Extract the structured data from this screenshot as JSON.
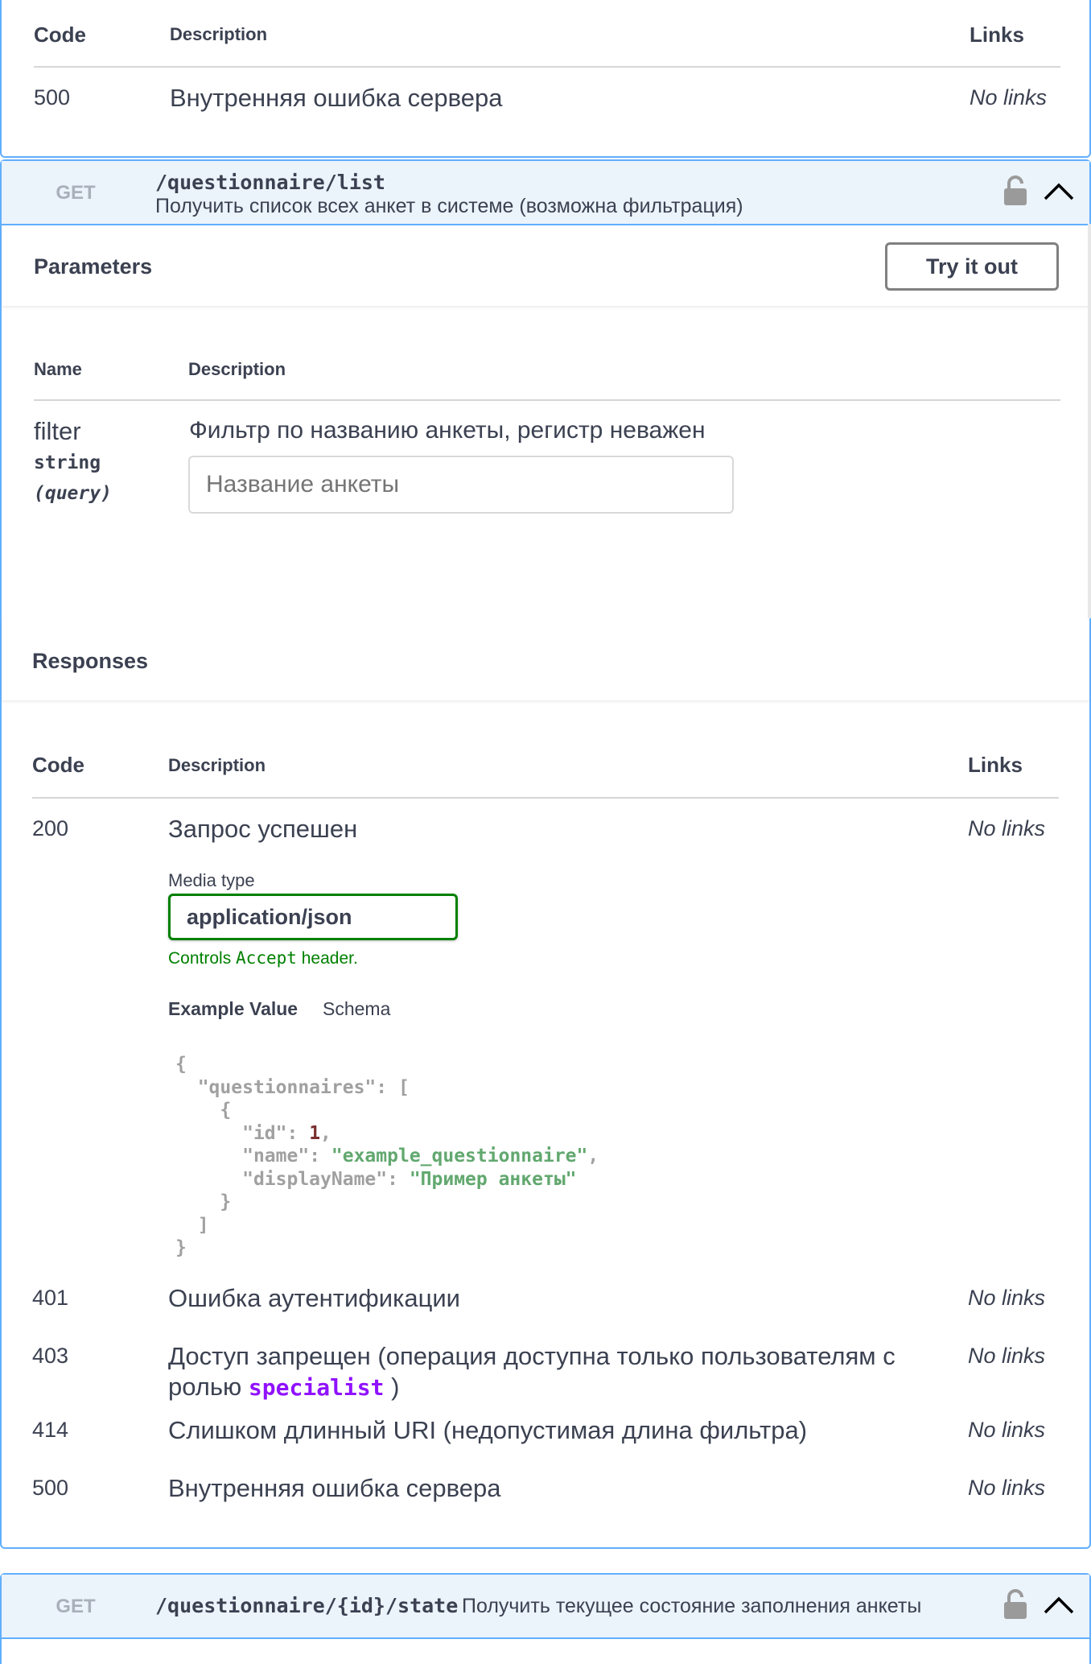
{
  "top_responses": {
    "headers": {
      "code": "Code",
      "description": "Description",
      "links": "Links"
    },
    "rows": [
      {
        "code": "500",
        "description": "Внутренняя ошибка сервера",
        "links": "No links"
      }
    ]
  },
  "op_list": {
    "method": "GET",
    "path": "/questionnaire/list",
    "summary": "Получить список всех анкет в системе (возможна фильтрация)",
    "parameters_title": "Parameters",
    "try_button": "Try it out",
    "param_headers": {
      "name": "Name",
      "description": "Description"
    },
    "param": {
      "name": "filter",
      "type": "string",
      "in": "(query)",
      "description": "Фильтр по названию анкеты, регистр неважен",
      "placeholder": "Название анкеты"
    },
    "responses_title": "Responses",
    "resp_headers": {
      "code": "Code",
      "description": "Description",
      "links": "Links"
    },
    "resp_200": {
      "code": "200",
      "description": "Запрос успешен",
      "links": "No links",
      "media_type_label": "Media type",
      "media_type": "application/json",
      "controls_prefix": "Controls ",
      "controls_code": "Accept",
      "controls_suffix": " header.",
      "tab_example": "Example Value",
      "tab_schema": "Schema",
      "example": {
        "l0": "{",
        "k_questionnaires": "\"questionnaires\"",
        "open_arr": ": [",
        "open_obj": "{",
        "k_id": "\"id\"",
        "v_id": "1",
        "k_name": "\"name\"",
        "v_name": "\"example_questionnaire\"",
        "k_display": "\"displayName\"",
        "v_display": "\"Пример анкеты\"",
        "close_obj": "}",
        "close_arr": "]",
        "l_end": "}"
      }
    },
    "resp_401": {
      "code": "401",
      "description": "Ошибка аутентификации",
      "links": "No links"
    },
    "resp_403": {
      "code": "403",
      "description_line1": "Доступ запрещен (операция доступна только пользователям с",
      "description_line2_prefix": "ролью ",
      "role": "specialist",
      "description_line2_suffix": " )",
      "links": "No links"
    },
    "resp_414": {
      "code": "414",
      "description": "Слишком длинный URI (недопустимая длина фильтра)",
      "links": "No links"
    },
    "resp_500": {
      "code": "500",
      "description": "Внутренняя ошибка сервера",
      "links": "No links"
    }
  },
  "op_state": {
    "method": "GET",
    "path": "/questionnaire/{id}/state",
    "summary": "Получить текущее состояние заполнения анкеты"
  },
  "colors": {
    "get_accent": "#61affe",
    "get_bg": "#ebf3fb",
    "media_border": "#008000",
    "role_color": "#9012fe"
  },
  "icons": [
    "lock-icon",
    "chevron-up-icon"
  ]
}
